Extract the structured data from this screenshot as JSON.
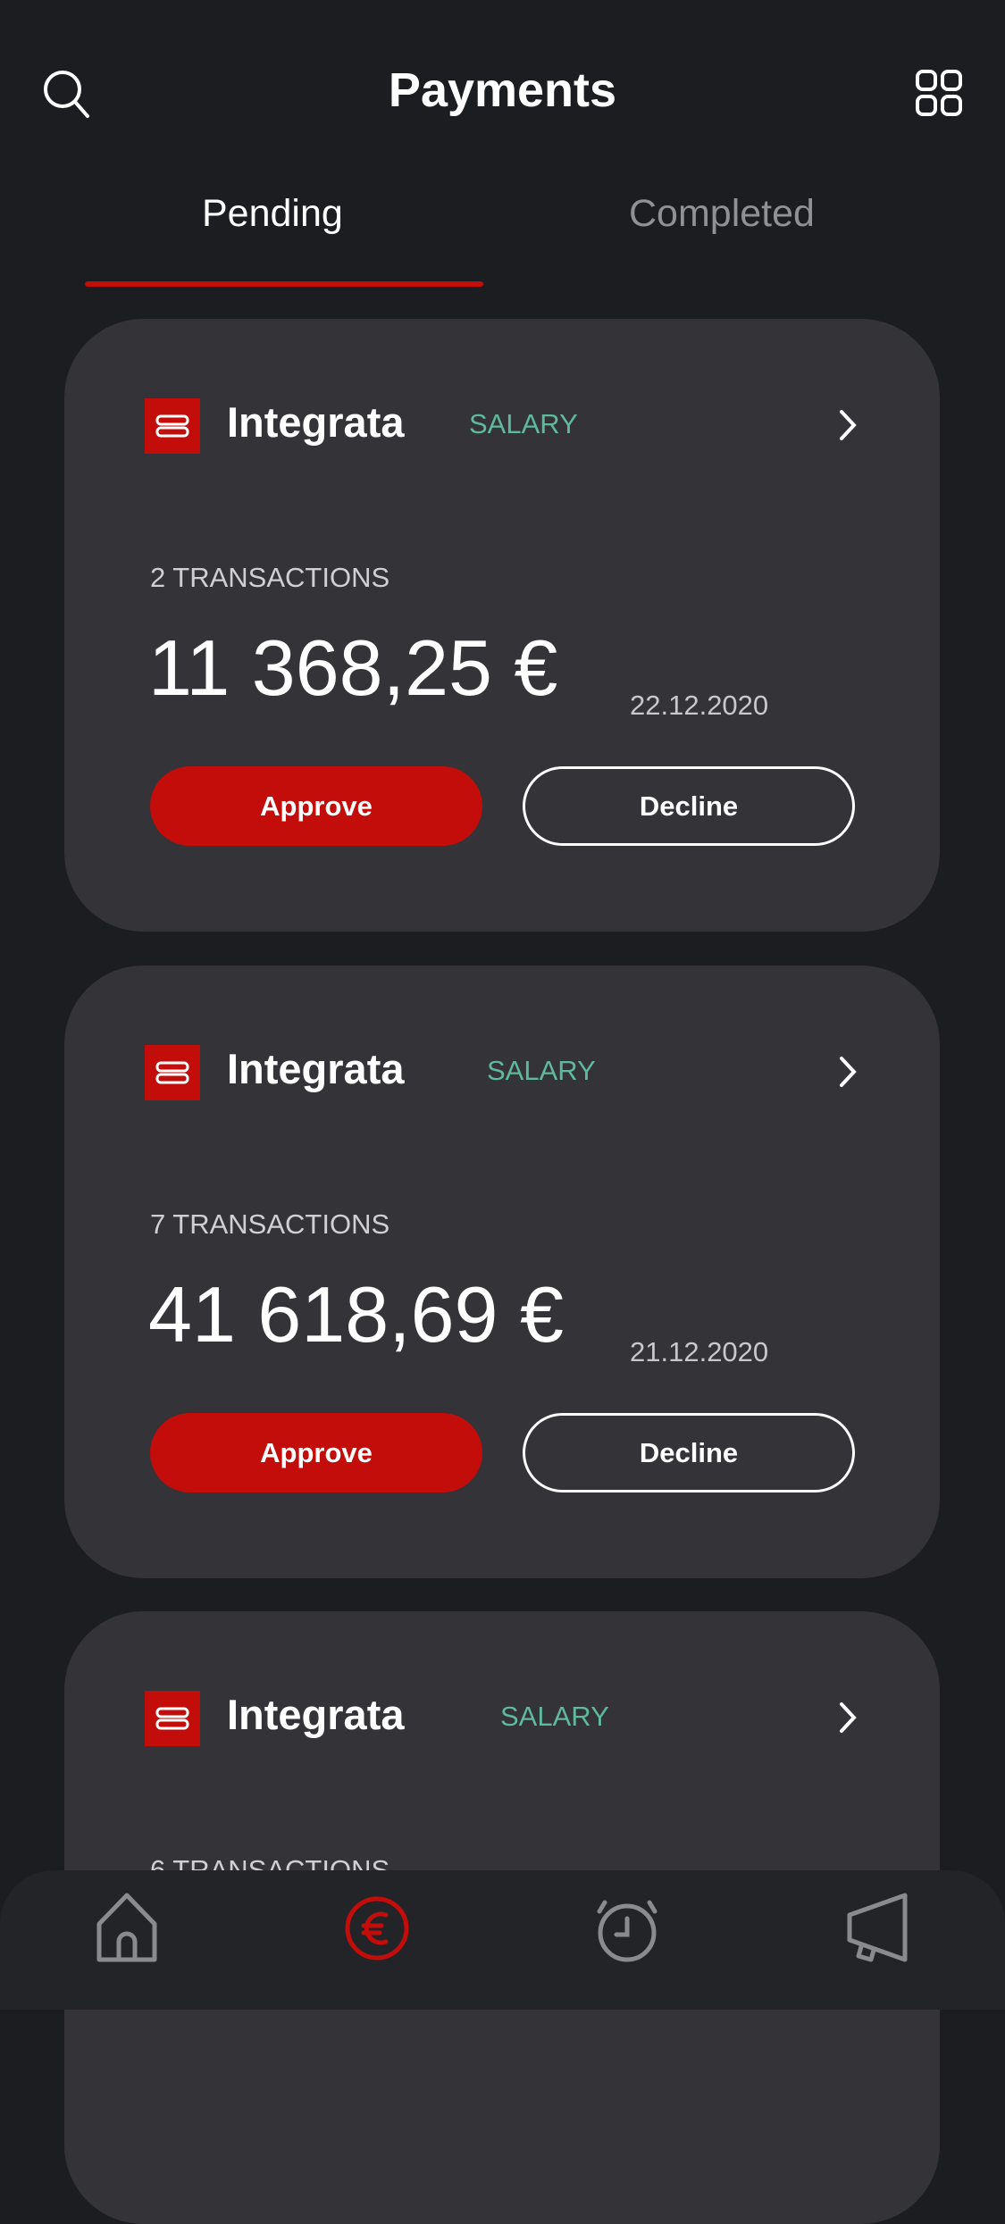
{
  "header": {
    "title": "Payments",
    "left_icon": "search-icon",
    "right_icon": "grid-icon"
  },
  "tabs": [
    {
      "label": "Pending",
      "active": true
    },
    {
      "label": "Completed",
      "active": false
    }
  ],
  "colors": {
    "accent": "#c30d0a",
    "tag": "#5fb99a",
    "card": "#343338",
    "background": "#1b1d20"
  },
  "cards": [
    {
      "company": "Integrata",
      "tag": "SALARY",
      "count": "2 TRANSACTIONS",
      "amount": "11 368,25 €",
      "date": "22.12.2020",
      "approve": "Approve",
      "decline": "Decline"
    },
    {
      "company": "Integrata",
      "tag": "SALARY",
      "count": "7 TRANSACTIONS",
      "amount": "41 618,69 €",
      "date": "21.12.2020",
      "approve": "Approve",
      "decline": "Decline"
    },
    {
      "company": "Integrata",
      "tag": "SALARY",
      "count": "6 TRANSACTIONS"
    }
  ],
  "nav": [
    {
      "icon": "home-icon"
    },
    {
      "icon": "euro-icon",
      "active": true
    },
    {
      "icon": "alarm-clock-icon"
    },
    {
      "icon": "megaphone-icon"
    }
  ]
}
